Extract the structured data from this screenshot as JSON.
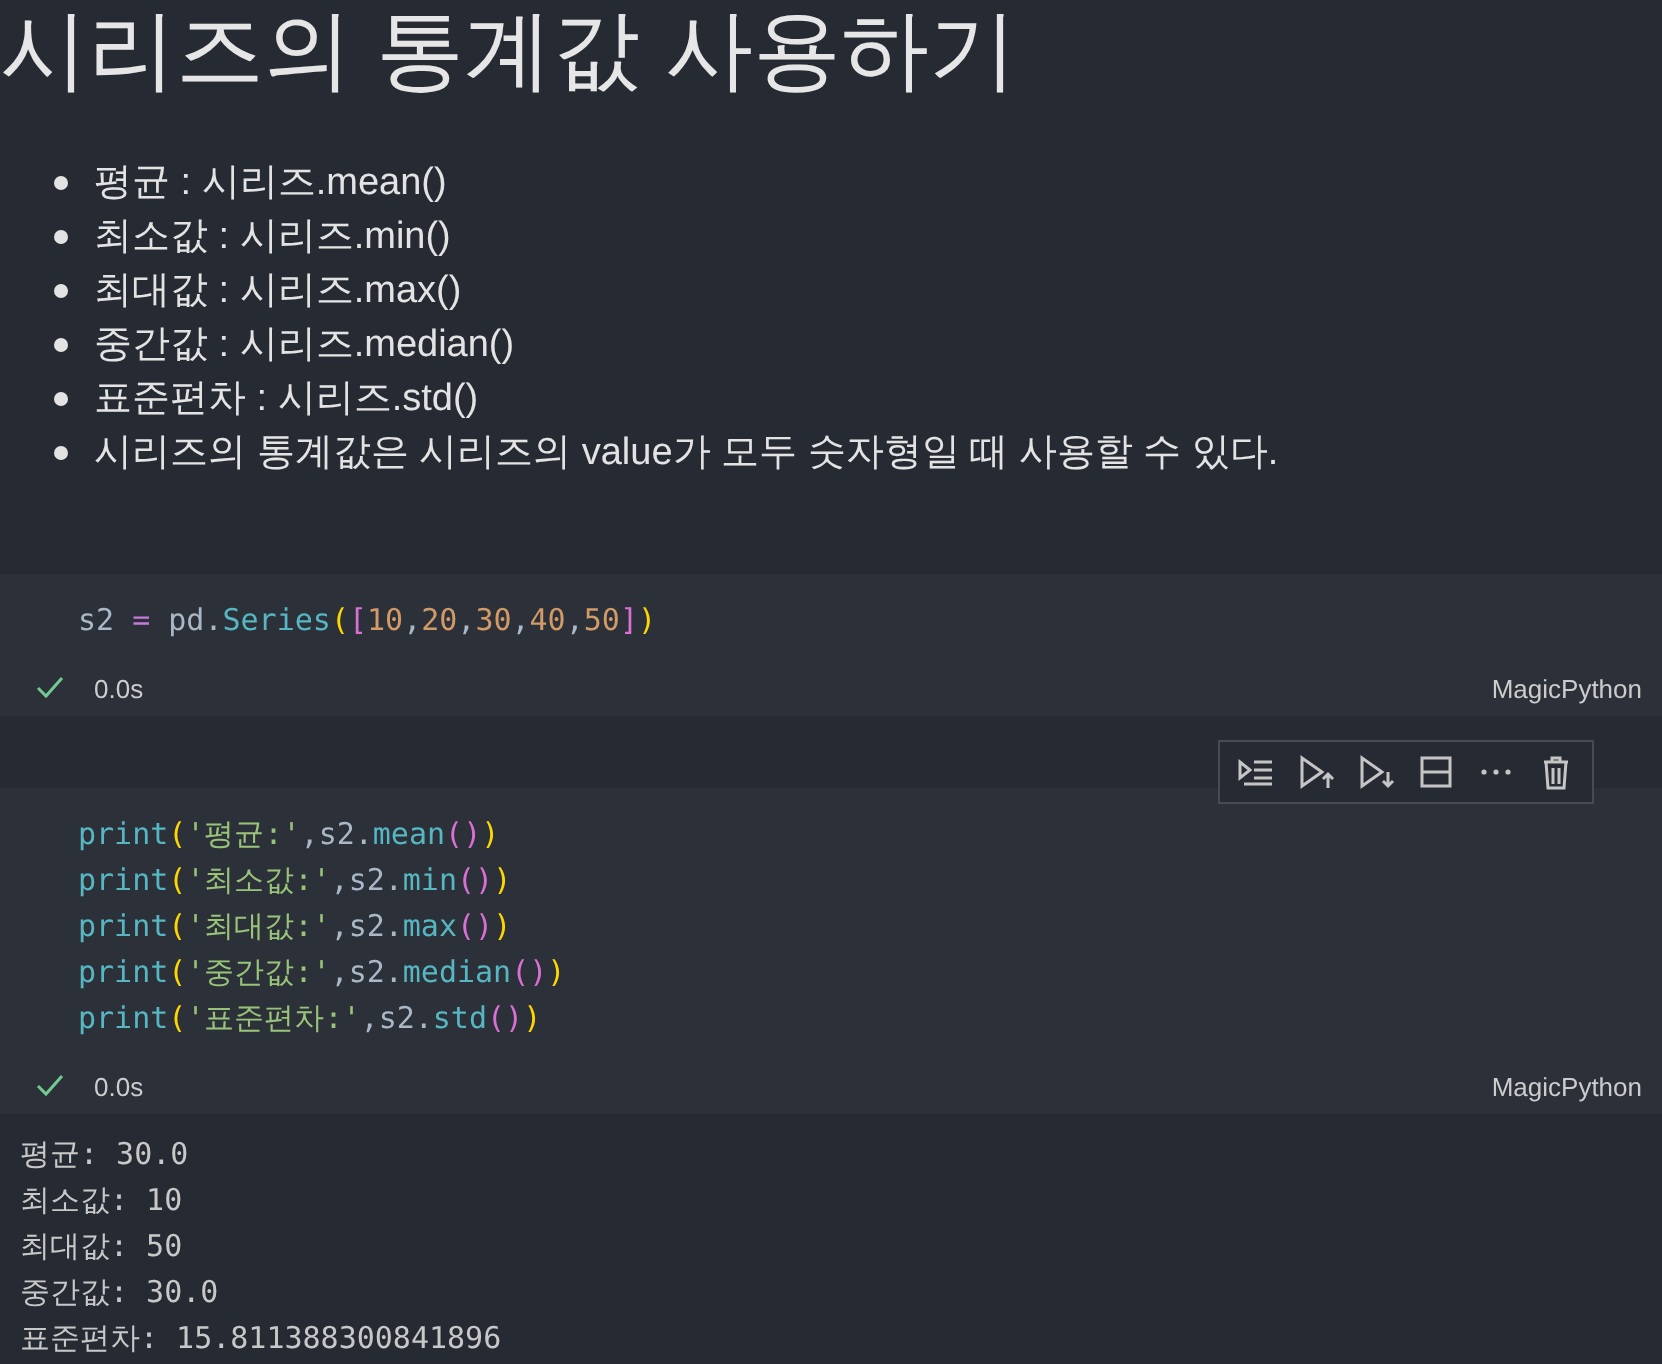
{
  "title": "시리즈의 통계값 사용하기",
  "bullets": [
    "평균 : 시리즈.mean()",
    "최소값 : 시리즈.min()",
    "최대값 : 시리즈.max()",
    "중간값 : 시리즈.median()",
    "표준편차 : 시리즈.std()",
    "시리즈의 통계값은 시리즈의 value가 모두 숫자형일 때 사용할 수 있다."
  ],
  "cells": [
    {
      "toolbar": false,
      "code": [
        "s2 = pd.Series([10,20,30,40,50])"
      ],
      "status": {
        "succeeded": true,
        "time": "0.0s",
        "language": "MagicPython"
      }
    },
    {
      "toolbar": true,
      "code": [
        "print('평균:',s2.mean())",
        "print('최소값:',s2.min())",
        "print('최대값:',s2.max())",
        "print('중간값:',s2.median())",
        "print('표준편차:',s2.std())"
      ],
      "status": {
        "succeeded": true,
        "time": "0.0s",
        "language": "MagicPython"
      },
      "output": [
        "평균: 30.0",
        "최소값: 10",
        "최대값: 50",
        "중간값: 30.0",
        "표준편차: 15.811388300841896"
      ]
    }
  ]
}
